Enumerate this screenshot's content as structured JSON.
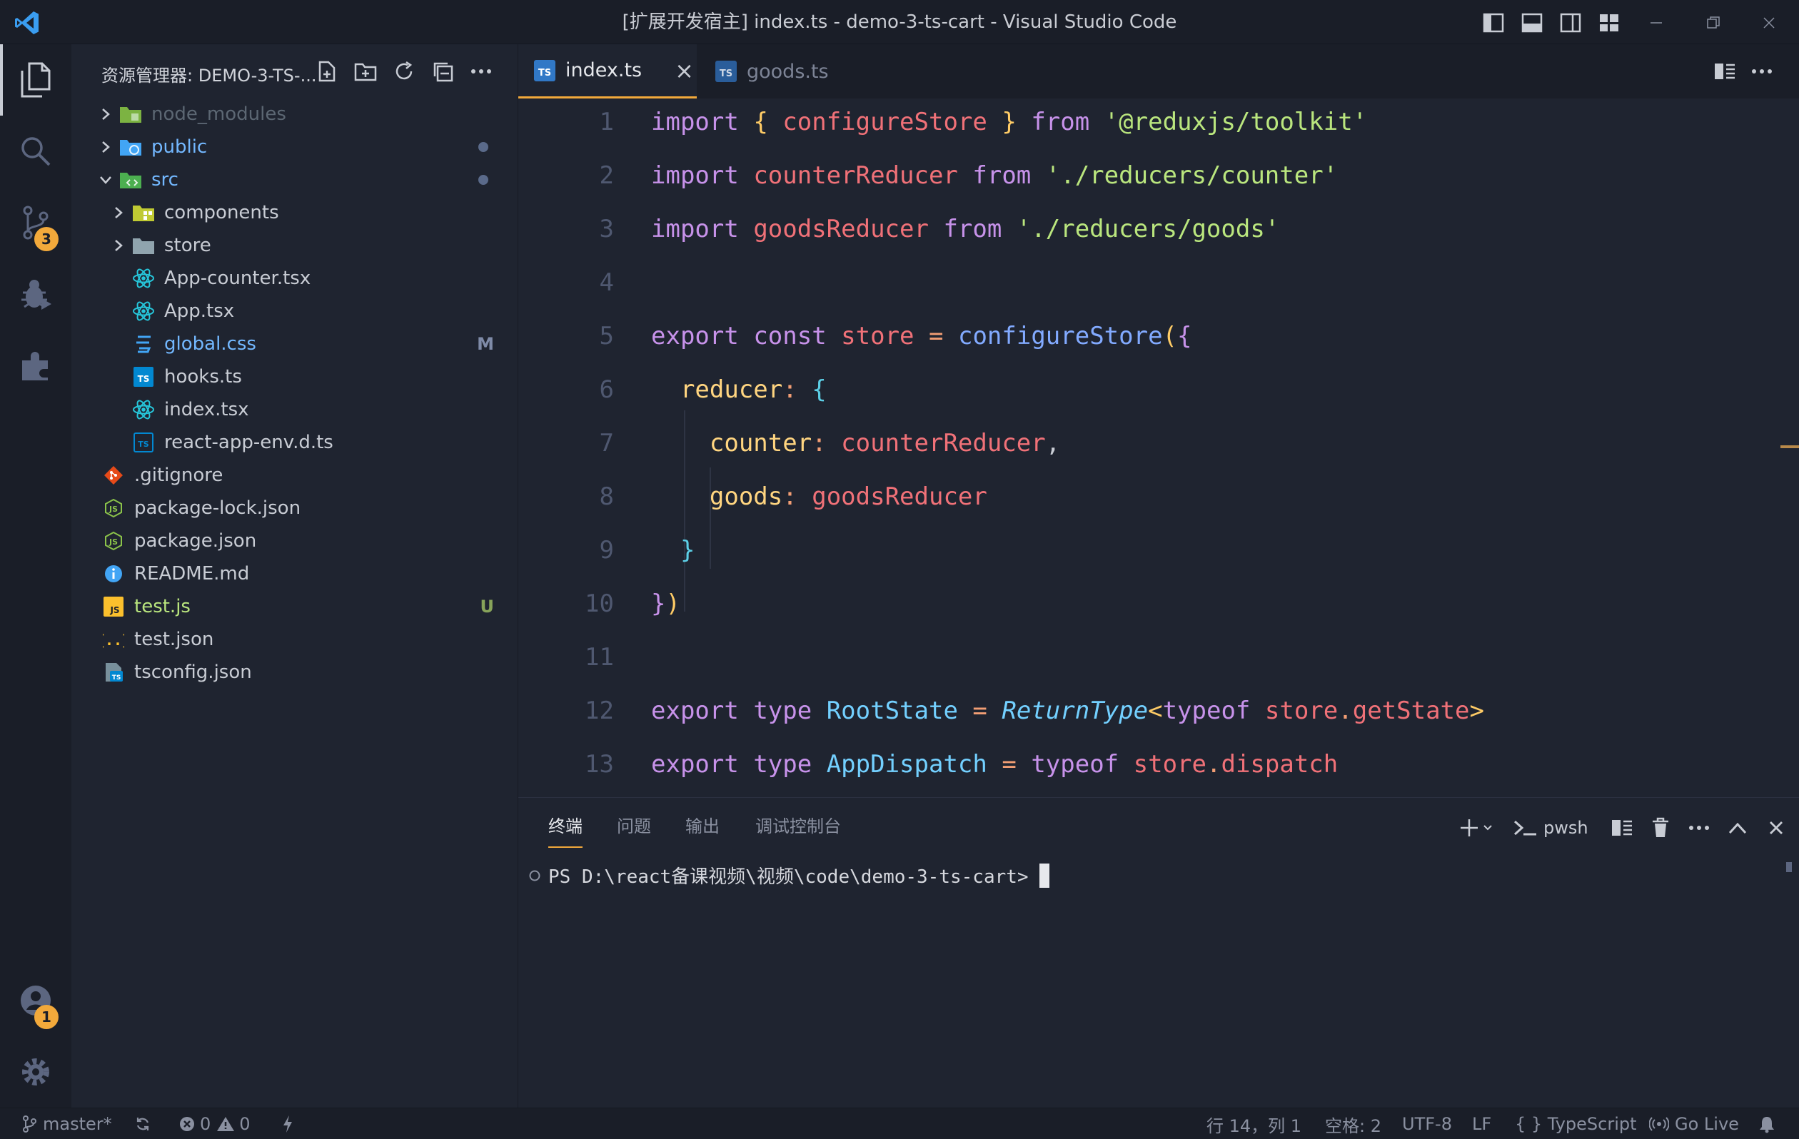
{
  "window": {
    "title": "[扩展开发宿主] index.ts - demo-3-ts-cart - Visual Studio Code"
  },
  "activity_bar": {
    "items": [
      "explorer-icon",
      "search-icon",
      "source-control-icon",
      "run-debug-icon",
      "extensions-icon"
    ],
    "source_control_badge": "3",
    "accounts_badge": "1"
  },
  "sidebar": {
    "title": "资源管理器: DEMO-3-TS-...",
    "tree": [
      {
        "label": "node_modules",
        "kind": "folder",
        "expanded": false,
        "depth": 0,
        "color": "#5c6773",
        "icon": "node-folder-icon"
      },
      {
        "label": "public",
        "kind": "folder",
        "expanded": false,
        "depth": 0,
        "color": "#73b8ff",
        "icon": "public-folder-icon",
        "decoration": "dot"
      },
      {
        "label": "src",
        "kind": "folder",
        "expanded": true,
        "depth": 0,
        "color": "#73b8ff",
        "icon": "src-folder-icon",
        "decoration": "dot"
      },
      {
        "label": "components",
        "kind": "folder",
        "expanded": false,
        "depth": 1,
        "color": "#c8ccd4",
        "icon": "components-folder-icon"
      },
      {
        "label": "store",
        "kind": "folder",
        "expanded": false,
        "depth": 1,
        "color": "#c8ccd4",
        "icon": "folder-icon"
      },
      {
        "label": "App-counter.tsx",
        "kind": "file",
        "depth": 1,
        "color": "#c8ccd4",
        "icon": "react-icon"
      },
      {
        "label": "App.tsx",
        "kind": "file",
        "depth": 1,
        "color": "#c8ccd4",
        "icon": "react-icon"
      },
      {
        "label": "global.css",
        "kind": "file",
        "depth": 1,
        "color": "#73b8ff",
        "icon": "css-icon",
        "decoration": "M"
      },
      {
        "label": "hooks.ts",
        "kind": "file",
        "depth": 1,
        "color": "#c8ccd4",
        "icon": "ts-icon"
      },
      {
        "label": "index.tsx",
        "kind": "file",
        "depth": 1,
        "color": "#c8ccd4",
        "icon": "react-icon"
      },
      {
        "label": "react-app-env.d.ts",
        "kind": "file",
        "depth": 1,
        "color": "#c8ccd4",
        "icon": "ts-def-icon"
      },
      {
        "label": ".gitignore",
        "kind": "file",
        "depth": 0,
        "color": "#c8ccd4",
        "icon": "git-icon"
      },
      {
        "label": "package-lock.json",
        "kind": "file",
        "depth": 0,
        "color": "#c8ccd4",
        "icon": "npm-icon"
      },
      {
        "label": "package.json",
        "kind": "file",
        "depth": 0,
        "color": "#c8ccd4",
        "icon": "npm-icon"
      },
      {
        "label": "README.md",
        "kind": "file",
        "depth": 0,
        "color": "#c8ccd4",
        "icon": "info-icon"
      },
      {
        "label": "test.js",
        "kind": "file",
        "depth": 0,
        "color": "#bae67e",
        "icon": "js-icon",
        "decoration": "U"
      },
      {
        "label": "test.json",
        "kind": "file",
        "depth": 0,
        "color": "#c8ccd4",
        "icon": "json-icon"
      },
      {
        "label": "tsconfig.json",
        "kind": "file",
        "depth": 0,
        "color": "#c8ccd4",
        "icon": "tsconfig-icon"
      }
    ]
  },
  "editor": {
    "tabs": [
      {
        "label": "index.ts",
        "active": true,
        "close": "×"
      },
      {
        "label": "goods.ts",
        "active": false
      }
    ],
    "lines": [
      {
        "n": "1",
        "tokens": [
          [
            "kw",
            "import"
          ],
          [
            "pl",
            " "
          ],
          [
            "br",
            "{"
          ],
          [
            "pl",
            " "
          ],
          [
            "id",
            "configureStore"
          ],
          [
            "pl",
            " "
          ],
          [
            "br",
            "}"
          ],
          [
            "pl",
            " "
          ],
          [
            "kw",
            "from"
          ],
          [
            "pl",
            " "
          ],
          [
            "str",
            "'@reduxjs/toolkit'"
          ]
        ]
      },
      {
        "n": "2",
        "tokens": [
          [
            "kw",
            "import"
          ],
          [
            "pl",
            " "
          ],
          [
            "id",
            "counterReducer"
          ],
          [
            "pl",
            " "
          ],
          [
            "kw",
            "from"
          ],
          [
            "pl",
            " "
          ],
          [
            "str",
            "'./reducers/counter'"
          ]
        ]
      },
      {
        "n": "3",
        "tokens": [
          [
            "kw",
            "import"
          ],
          [
            "pl",
            " "
          ],
          [
            "id",
            "goodsReducer"
          ],
          [
            "pl",
            " "
          ],
          [
            "kw",
            "from"
          ],
          [
            "pl",
            " "
          ],
          [
            "str",
            "'./reducers/goods'"
          ]
        ]
      },
      {
        "n": "4",
        "tokens": []
      },
      {
        "n": "5",
        "tokens": [
          [
            "kw",
            "export"
          ],
          [
            "pl",
            " "
          ],
          [
            "kw",
            "const"
          ],
          [
            "pl",
            " "
          ],
          [
            "id",
            "store"
          ],
          [
            "pl",
            " "
          ],
          [
            "op",
            "="
          ],
          [
            "pl",
            " "
          ],
          [
            "fn",
            "configureStore"
          ],
          [
            "br",
            "("
          ],
          [
            "br2",
            "{"
          ]
        ]
      },
      {
        "n": "6",
        "tokens": [
          [
            "pl",
            "  "
          ],
          [
            "prop",
            "reducer"
          ],
          [
            "op",
            ":"
          ],
          [
            "pl",
            " "
          ],
          [
            "br3",
            "{"
          ]
        ]
      },
      {
        "n": "7",
        "tokens": [
          [
            "pl",
            "    "
          ],
          [
            "prop",
            "counter"
          ],
          [
            "op",
            ":"
          ],
          [
            "pl",
            " "
          ],
          [
            "id",
            "counterReducer"
          ],
          [
            "pl",
            ","
          ]
        ]
      },
      {
        "n": "8",
        "tokens": [
          [
            "pl",
            "    "
          ],
          [
            "prop",
            "goods"
          ],
          [
            "op",
            ":"
          ],
          [
            "pl",
            " "
          ],
          [
            "id",
            "goodsReducer"
          ]
        ]
      },
      {
        "n": "9",
        "tokens": [
          [
            "pl",
            "  "
          ],
          [
            "br3",
            "}"
          ]
        ]
      },
      {
        "n": "10",
        "tokens": [
          [
            "br2",
            "}"
          ],
          [
            "br",
            ")"
          ]
        ]
      },
      {
        "n": "11",
        "tokens": []
      },
      {
        "n": "12",
        "tokens": [
          [
            "kw",
            "export"
          ],
          [
            "pl",
            " "
          ],
          [
            "kw",
            "type"
          ],
          [
            "pl",
            " "
          ],
          [
            "ty",
            "RootState"
          ],
          [
            "pl",
            " "
          ],
          [
            "op",
            "="
          ],
          [
            "pl",
            " "
          ],
          [
            "it",
            "ReturnType"
          ],
          [
            "kw2",
            "<"
          ],
          [
            "kw",
            "typeof"
          ],
          [
            "pl",
            " "
          ],
          [
            "id",
            "store"
          ],
          [
            "op",
            "."
          ],
          [
            "id",
            "getState"
          ],
          [
            "kw2",
            ">"
          ]
        ]
      },
      {
        "n": "13",
        "tokens": [
          [
            "kw",
            "export"
          ],
          [
            "pl",
            " "
          ],
          [
            "kw",
            "type"
          ],
          [
            "pl",
            " "
          ],
          [
            "ty",
            "AppDispatch"
          ],
          [
            "pl",
            " "
          ],
          [
            "op",
            "="
          ],
          [
            "pl",
            " "
          ],
          [
            "kw",
            "typeof"
          ],
          [
            "pl",
            " "
          ],
          [
            "id",
            "store"
          ],
          [
            "op",
            "."
          ],
          [
            "id",
            "dispatch"
          ]
        ]
      }
    ]
  },
  "panel": {
    "tabs": [
      "终端",
      "问题",
      "输出",
      "调试控制台"
    ],
    "active_tab": "终端",
    "shell_label": "pwsh",
    "terminal_prompt": "PS D:\\react备课视频\\视频\\code\\demo-3-ts-cart> "
  },
  "statusbar": {
    "branch": "master*",
    "errors": "0",
    "warnings": "0",
    "position": "行 14，列 1",
    "spaces": "空格: 2",
    "encoding": "UTF-8",
    "eol": "LF",
    "language": "{ } TypeScript",
    "golive": "Go Live"
  },
  "colors": {
    "accent": "#f2a93b",
    "background": "#1f2430",
    "chrome": "#1a1e28"
  }
}
